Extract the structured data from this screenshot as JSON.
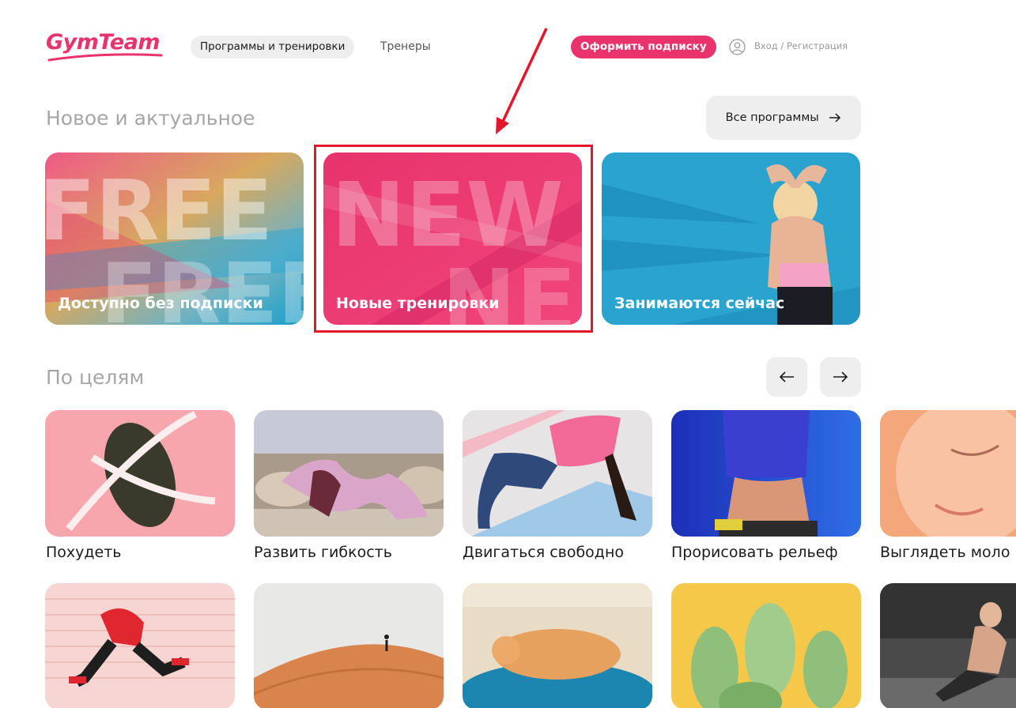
{
  "header": {
    "logo": "GymTeam",
    "nav": [
      {
        "label": "Программы и тренировки",
        "active": true
      },
      {
        "label": "Тренеры",
        "active": false
      }
    ],
    "subscribe_label": "Оформить подписку",
    "login_label": "Вход / Регистрация",
    "user_icon": "user-circle-icon"
  },
  "new_section": {
    "title": "Новое и актуальное",
    "all_button": "Все программы",
    "all_button_icon": "arrow-right-icon",
    "cards": [
      {
        "label": "Доступно без подписки",
        "art_text": "FREE"
      },
      {
        "label": "Новые тренировки",
        "art_text": "NEW",
        "highlighted": true
      },
      {
        "label": "Занимаются сейчас"
      }
    ]
  },
  "goals_section": {
    "title": "По целям",
    "prev_icon": "arrow-left-icon",
    "next_icon": "arrow-right-icon",
    "tiles": [
      {
        "label": "Похудеть"
      },
      {
        "label": "Развить гибкость"
      },
      {
        "label": "Двигаться свободно"
      },
      {
        "label": "Прорисовать рельеф"
      },
      {
        "label": "Выглядеть моло"
      }
    ],
    "tiles_row2": [
      {},
      {},
      {},
      {},
      {}
    ]
  },
  "colors": {
    "brand": "#e8336d",
    "annotation_red": "#e3162a",
    "pill_bg": "#eeeeee",
    "muted_text": "#a6a6a6"
  }
}
